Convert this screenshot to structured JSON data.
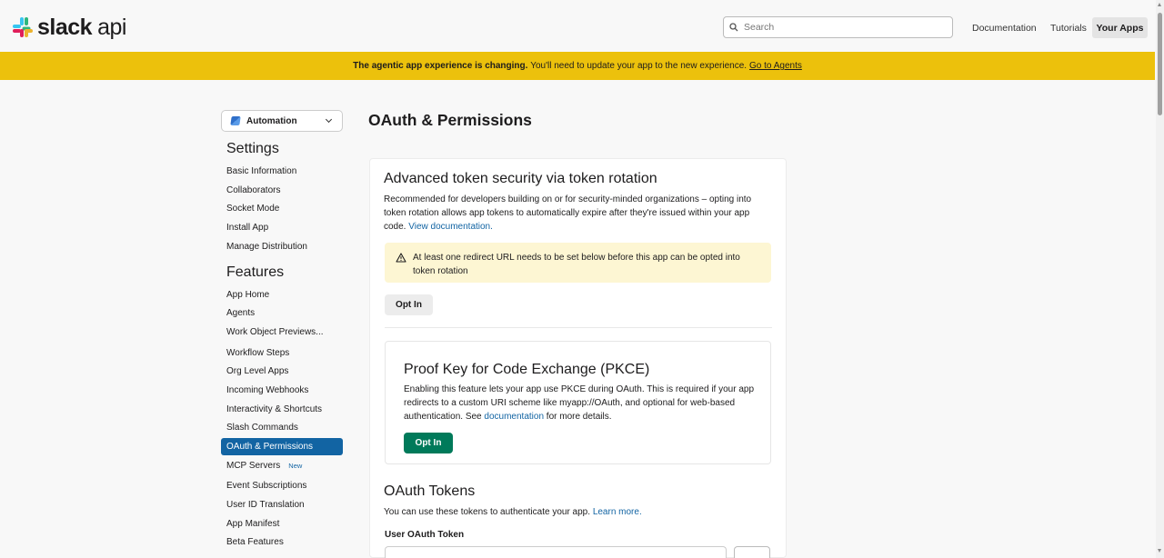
{
  "header": {
    "logo_brand": "slack",
    "logo_suffix": "api",
    "search_placeholder": "Search",
    "nav": [
      "Documentation",
      "Tutorials",
      "Your Apps"
    ]
  },
  "banner": {
    "bold": "The agentic app experience is changing.",
    "text": "You'll need to update your app to the new experience.",
    "link": "Go to Agents"
  },
  "sidebar": {
    "app_name": "Automation",
    "settings_heading": "Settings",
    "settings_items": [
      "Basic Information",
      "Collaborators",
      "Socket Mode",
      "Install App",
      "Manage Distribution"
    ],
    "features_heading": "Features",
    "features_items": [
      "App Home",
      "Agents",
      "Work Object Previews...",
      "Workflow Steps",
      "Org Level Apps",
      "Incoming Webhooks",
      "Interactivity & Shortcuts",
      "Slash Commands",
      "OAuth & Permissions",
      "MCP Servers",
      "Event Subscriptions",
      "User ID Translation",
      "App Manifest",
      "Beta Features"
    ],
    "new_badge": "New"
  },
  "main": {
    "title": "OAuth & Permissions",
    "rotation": {
      "title": "Advanced token security via token rotation",
      "line1": "Recommended for developers building on or for security-minded organizations – opting into",
      "line2": "token rotation allows app tokens to automatically expire after they're issued within your app",
      "line3": "code.",
      "link": "View documentation.",
      "warning_line1": "At least one redirect URL needs to be set below before this app can be opted into",
      "warning_line2": "token rotation",
      "button": "Opt In"
    },
    "pkce": {
      "title": "Proof Key for Code Exchange (PKCE)",
      "line1": "Enabling this feature lets your app use PKCE during OAuth. This is required if your app",
      "line2": "redirects to a custom URI scheme like myapp://OAuth, and optional for web-based",
      "line3_pre": "authentication. See",
      "link": "documentation",
      "line3_post": "for more details.",
      "button": "Opt In"
    },
    "tokens": {
      "title": "OAuth Tokens",
      "text": "You can use these tokens to authenticate your app.",
      "link": "Learn more.",
      "user_label": "User OAuth Token"
    }
  }
}
